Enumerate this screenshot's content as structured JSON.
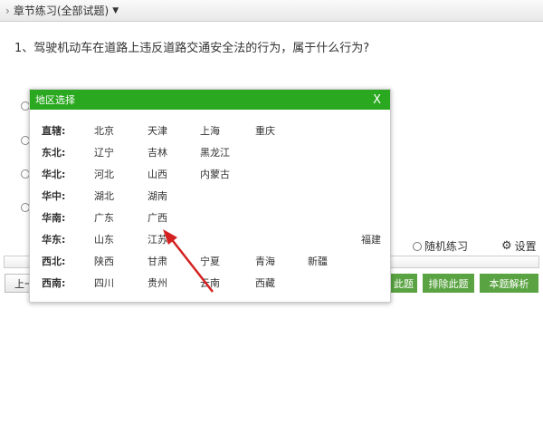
{
  "header": {
    "title": "章节练习(全部试题)"
  },
  "question": "1、驾驶机动车在道路上违反道路交通安全法的行为，属于什么行为?",
  "options": {
    "random": "随机练习",
    "settings": "设置"
  },
  "buttons": {
    "prev": "上一",
    "hidden": "此题",
    "exclude": "排除此题",
    "analysis": "本题解析"
  },
  "modal": {
    "title": "地区选择",
    "close": "X",
    "rows": [
      {
        "label": "直辖:",
        "items": [
          "北京",
          "天津",
          "上海",
          "重庆"
        ]
      },
      {
        "label": "东北:",
        "items": [
          "辽宁",
          "吉林",
          "黑龙江"
        ]
      },
      {
        "label": "华北:",
        "items": [
          "河北",
          "山西",
          "内蒙古"
        ]
      },
      {
        "label": "华中:",
        "items": [
          "湖北",
          "湖南"
        ]
      },
      {
        "label": "华南:",
        "items": [
          "广东",
          "广西"
        ]
      },
      {
        "label": "华东:",
        "items": [
          "山东",
          "江苏"
        ],
        "extra": "福建"
      },
      {
        "label": "西北:",
        "items": [
          "陕西",
          "甘肃",
          "宁夏",
          "青海",
          "新疆"
        ]
      },
      {
        "label": "西南:",
        "items": [
          "四川",
          "贵州",
          "云南",
          "西藏"
        ]
      }
    ]
  },
  "colors": {
    "accent": "#2aa81f",
    "button": "#5aa342",
    "arrow": "#d42020"
  }
}
